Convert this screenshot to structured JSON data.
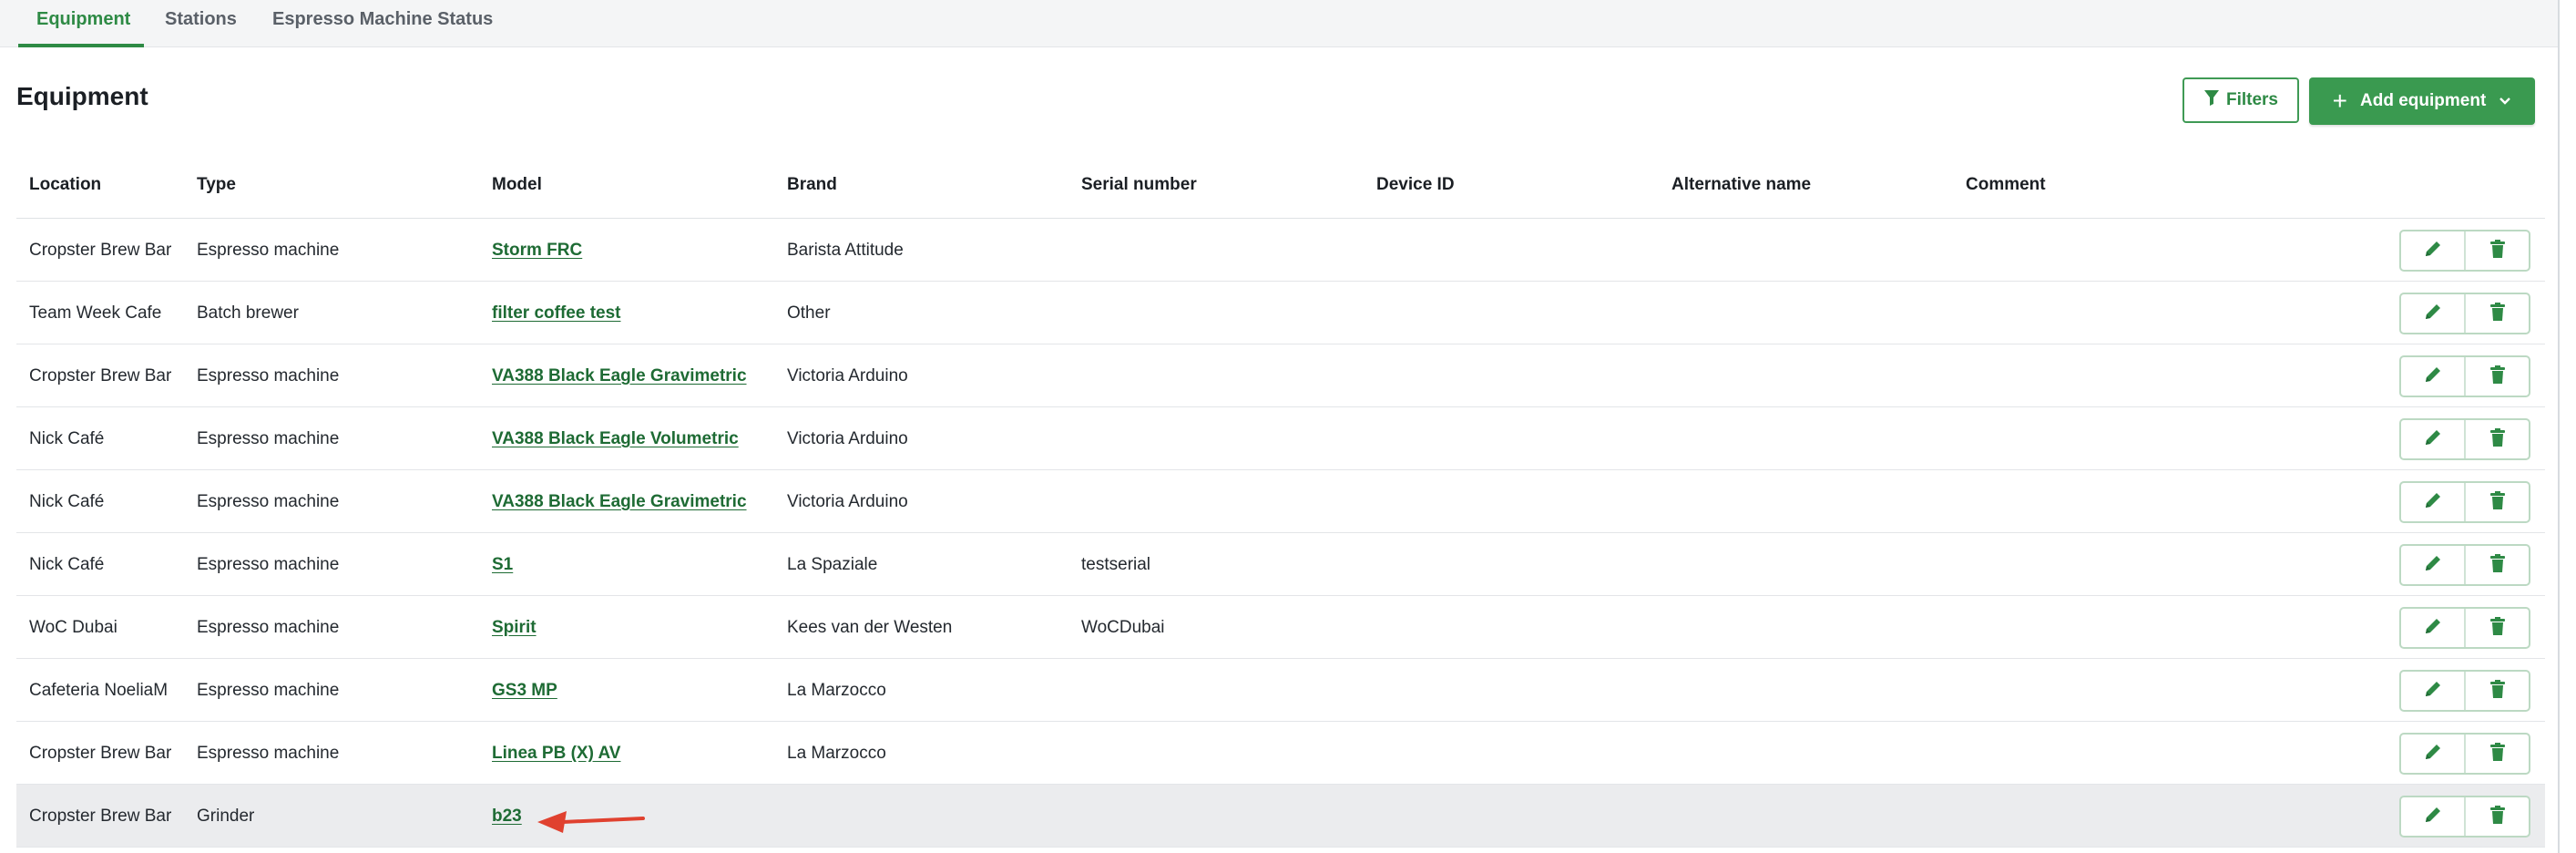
{
  "tabs": [
    {
      "label": "Equipment",
      "active": true
    },
    {
      "label": "Stations",
      "active": false
    },
    {
      "label": "Espresso Machine Status",
      "active": false
    }
  ],
  "page": {
    "title": "Equipment"
  },
  "toolbar": {
    "filters_label": "Filters",
    "add_label": "Add equipment"
  },
  "colors": {
    "accent": "#3a9a50",
    "link": "#1e6b34",
    "annotation_arrow": "#e0412f"
  },
  "icons": {
    "filter": "filter-icon",
    "add": "plus-icon",
    "dropdown": "chevron-down-icon",
    "edit": "pencil-icon",
    "delete": "trash-icon",
    "annotation": "red-arrow-icon"
  },
  "table": {
    "columns": [
      "Location",
      "Type",
      "Model",
      "Brand",
      "Serial number",
      "Device ID",
      "Alternative name",
      "Comment"
    ],
    "rows": [
      {
        "location": "Cropster Brew Bar",
        "type": "Espresso machine",
        "model": "Storm FRC",
        "brand": "Barista Attitude",
        "serial": "",
        "device_id": "",
        "alt_name": "",
        "comment": ""
      },
      {
        "location": "Team Week Cafe",
        "type": "Batch brewer",
        "model": "filter coffee test",
        "brand": "Other",
        "serial": "",
        "device_id": "",
        "alt_name": "",
        "comment": ""
      },
      {
        "location": "Cropster Brew Bar",
        "type": "Espresso machine",
        "model": "VA388 Black Eagle Gravimetric",
        "brand": "Victoria Arduino",
        "serial": "",
        "device_id": "",
        "alt_name": "",
        "comment": ""
      },
      {
        "location": "Nick Café",
        "type": "Espresso machine",
        "model": "VA388 Black Eagle Volumetric",
        "brand": "Victoria Arduino",
        "serial": "",
        "device_id": "",
        "alt_name": "",
        "comment": ""
      },
      {
        "location": "Nick Café",
        "type": "Espresso machine",
        "model": "VA388 Black Eagle Gravimetric",
        "brand": "Victoria Arduino",
        "serial": "",
        "device_id": "",
        "alt_name": "",
        "comment": ""
      },
      {
        "location": "Nick Café",
        "type": "Espresso machine",
        "model": "S1",
        "brand": "La Spaziale",
        "serial": "testserial",
        "device_id": "",
        "alt_name": "",
        "comment": ""
      },
      {
        "location": "WoC Dubai",
        "type": "Espresso machine",
        "model": "Spirit",
        "brand": "Kees van der Westen",
        "serial": "WoCDubai",
        "device_id": "",
        "alt_name": "",
        "comment": ""
      },
      {
        "location": "Cafeteria NoeliaM",
        "type": "Espresso machine",
        "model": "GS3 MP",
        "brand": "La Marzocco",
        "serial": "",
        "device_id": "",
        "alt_name": "",
        "comment": ""
      },
      {
        "location": "Cropster Brew Bar",
        "type": "Espresso machine",
        "model": "Linea PB (X) AV",
        "brand": "La Marzocco",
        "serial": "",
        "device_id": "",
        "alt_name": "",
        "comment": ""
      },
      {
        "location": "Cropster Brew Bar",
        "type": "Grinder",
        "model": "b23",
        "brand": "",
        "serial": "",
        "device_id": "",
        "alt_name": "",
        "comment": "",
        "highlighted": true
      }
    ]
  }
}
